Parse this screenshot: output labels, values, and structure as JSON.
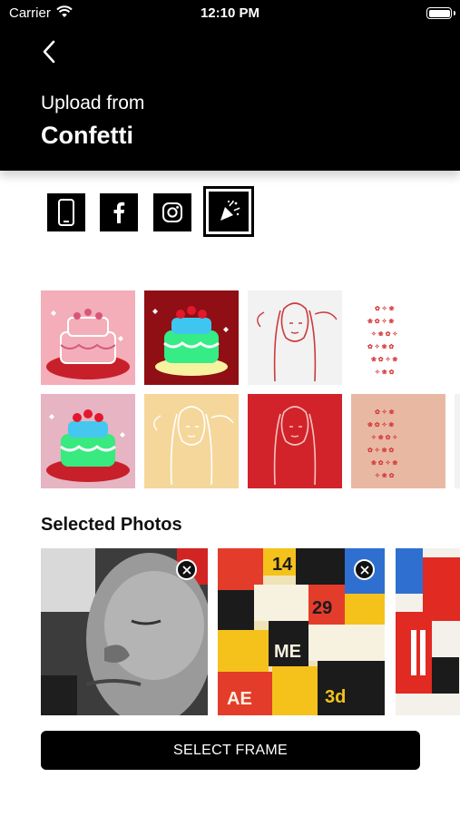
{
  "status_bar": {
    "carrier": "Carrier",
    "time": "12:10 PM"
  },
  "header": {
    "subtitle": "Upload from",
    "title": "Confetti"
  },
  "sources": [
    {
      "icon": "phone-icon",
      "selected": false
    },
    {
      "icon": "facebook-icon",
      "selected": false
    },
    {
      "icon": "instagram-icon",
      "selected": false
    },
    {
      "icon": "confetti-icon",
      "selected": true
    }
  ],
  "gallery": [
    {
      "subject": "cake",
      "colors": {
        "bg": "#f3aeb9",
        "main": "#d7577a"
      }
    },
    {
      "subject": "cake",
      "colors": {
        "bg": "#8f0f14",
        "main": "#35ec86"
      }
    },
    {
      "subject": "portrait",
      "colors": {
        "bg": "#f2f2f2",
        "main": "#cc3a3a"
      }
    },
    {
      "subject": "pattern",
      "colors": {
        "bg": "#ffffff",
        "main": "#d43a3a"
      }
    },
    {
      "subject": "cake",
      "colors": {
        "bg": "#e6b4c3",
        "main": "#38ea7f"
      }
    },
    {
      "subject": "portrait",
      "colors": {
        "bg": "#f5d79b",
        "main": "#ffffff"
      }
    },
    {
      "subject": "portrait",
      "colors": {
        "bg": "#d2232a",
        "main": "#f5c2c2"
      }
    },
    {
      "subject": "pattern",
      "colors": {
        "bg": "#e8b8a3",
        "main": "#d43a3a"
      }
    },
    {
      "subject": "portrait",
      "colors": {
        "bg": "#f2f2f2",
        "main": "#cc3a3a"
      }
    }
  ],
  "selected_section": {
    "title": "Selected Photos"
  },
  "selected_photos": [
    {
      "subject": "grayscale face collage",
      "removable": true
    },
    {
      "subject": "colorful poster collage",
      "removable": true
    },
    {
      "subject": "red white collage",
      "removable": false
    }
  ],
  "cta": {
    "label": "SELECT FRAME"
  }
}
